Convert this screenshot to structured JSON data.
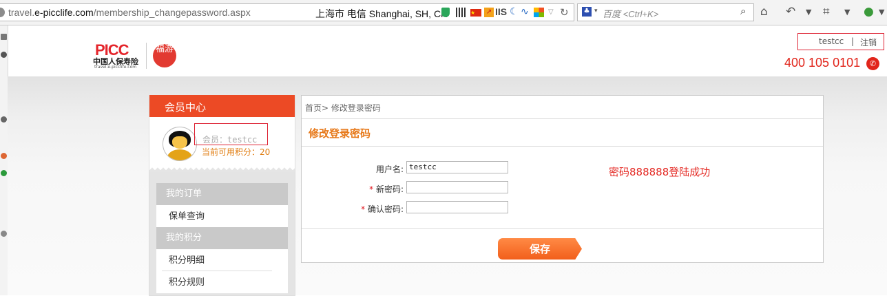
{
  "browser": {
    "url_prefix": "travel.",
    "url_domain": "e-picclife.com",
    "url_path": "/membership_changepassword.aspx",
    "geo": "上海市 电信   Shanghai, SH, CN",
    "addon_iis": "IIS",
    "search_placeholder": "百度 <Ctrl+K>",
    "icons": [
      "site-info-icon",
      "shield-icon",
      "qr-code-icon",
      "china-flag-icon",
      "chart-icon",
      "iis-icon",
      "moon-icon",
      "wave-icon",
      "windows-icon",
      "dropdown-icon",
      "reload-icon",
      "baidu-icon",
      "search-icon",
      "home-icon",
      "back-icon",
      "crop-icon",
      "globe-icon"
    ]
  },
  "header": {
    "logo_picc": "PICC",
    "logo_cn": "中国人保寿险",
    "logo_url": "travel.e-picclife.com",
    "logo_seal": "福游",
    "username": "testcc",
    "separator": "|",
    "logout": "注销",
    "hotline": "400 105 0101"
  },
  "member_panel": {
    "title": "会员中心",
    "member_label": "会员：testcc",
    "points_label": "当前可用积分：20",
    "nav": [
      {
        "type": "head",
        "label": "我的订单"
      },
      {
        "type": "item",
        "label": "保单查询"
      },
      {
        "type": "head",
        "label": "我的积分"
      },
      {
        "type": "item",
        "label": "积分明细"
      },
      {
        "type": "item",
        "label": "积分规则"
      }
    ]
  },
  "password_panel": {
    "breadcrumb": "首页> 修改登录密码",
    "title": "修改登录密码",
    "fields": [
      {
        "label": "用户名:",
        "required": false,
        "value": "testcc"
      },
      {
        "label": "新密码:",
        "required": true,
        "value": ""
      },
      {
        "label": "确认密码:",
        "required": true,
        "value": ""
      }
    ],
    "required_mark": "*",
    "note": "密码888888登陆成功",
    "save_label": "保存"
  },
  "colors": {
    "brand_red": "#e4252b",
    "header_orange": "#ec4a25",
    "title_orange": "#e7791a",
    "button_orange": "#f25f1b"
  }
}
